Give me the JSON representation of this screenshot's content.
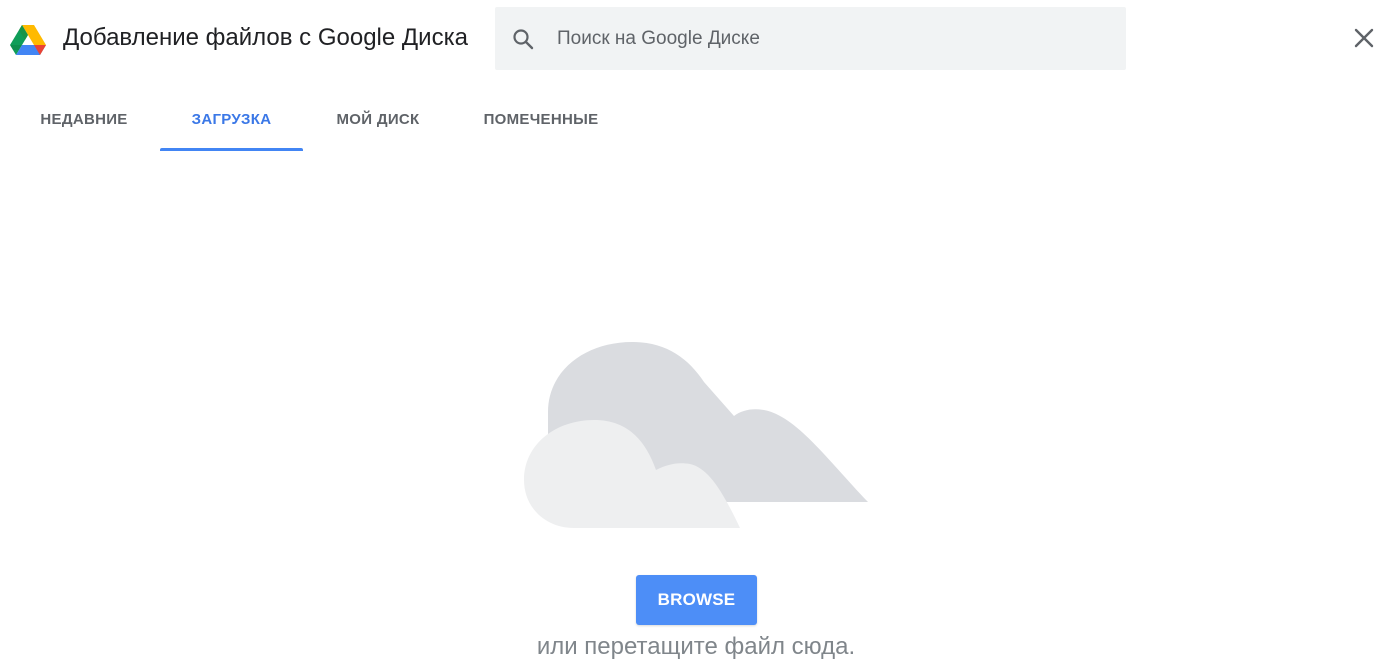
{
  "header": {
    "title": "Добавление файлов с Google Диска",
    "search_placeholder": "Поиск на Google Диске",
    "logo_icon": "google-drive-icon",
    "search_icon": "search-icon",
    "close_icon": "close-icon"
  },
  "tabs": [
    {
      "label": "НЕДАВНИЕ",
      "active": false
    },
    {
      "label": "ЗАГРУЗКА",
      "active": true
    },
    {
      "label": "МОЙ ДИСК",
      "active": false
    },
    {
      "label": "ПОМЕЧЕННЫЕ",
      "active": false
    }
  ],
  "upload": {
    "illustration_icon": "cloud-icon",
    "browse_label": "BROWSE",
    "drop_hint": "или перетащите файл сюда."
  },
  "colors": {
    "accent": "#4285f4",
    "active_tab_text": "#3b78e7",
    "browse_button": "#4d8ef7",
    "search_background": "#f1f3f4",
    "cloud_back": "#dadce0",
    "cloud_front": "#eeeff0"
  }
}
